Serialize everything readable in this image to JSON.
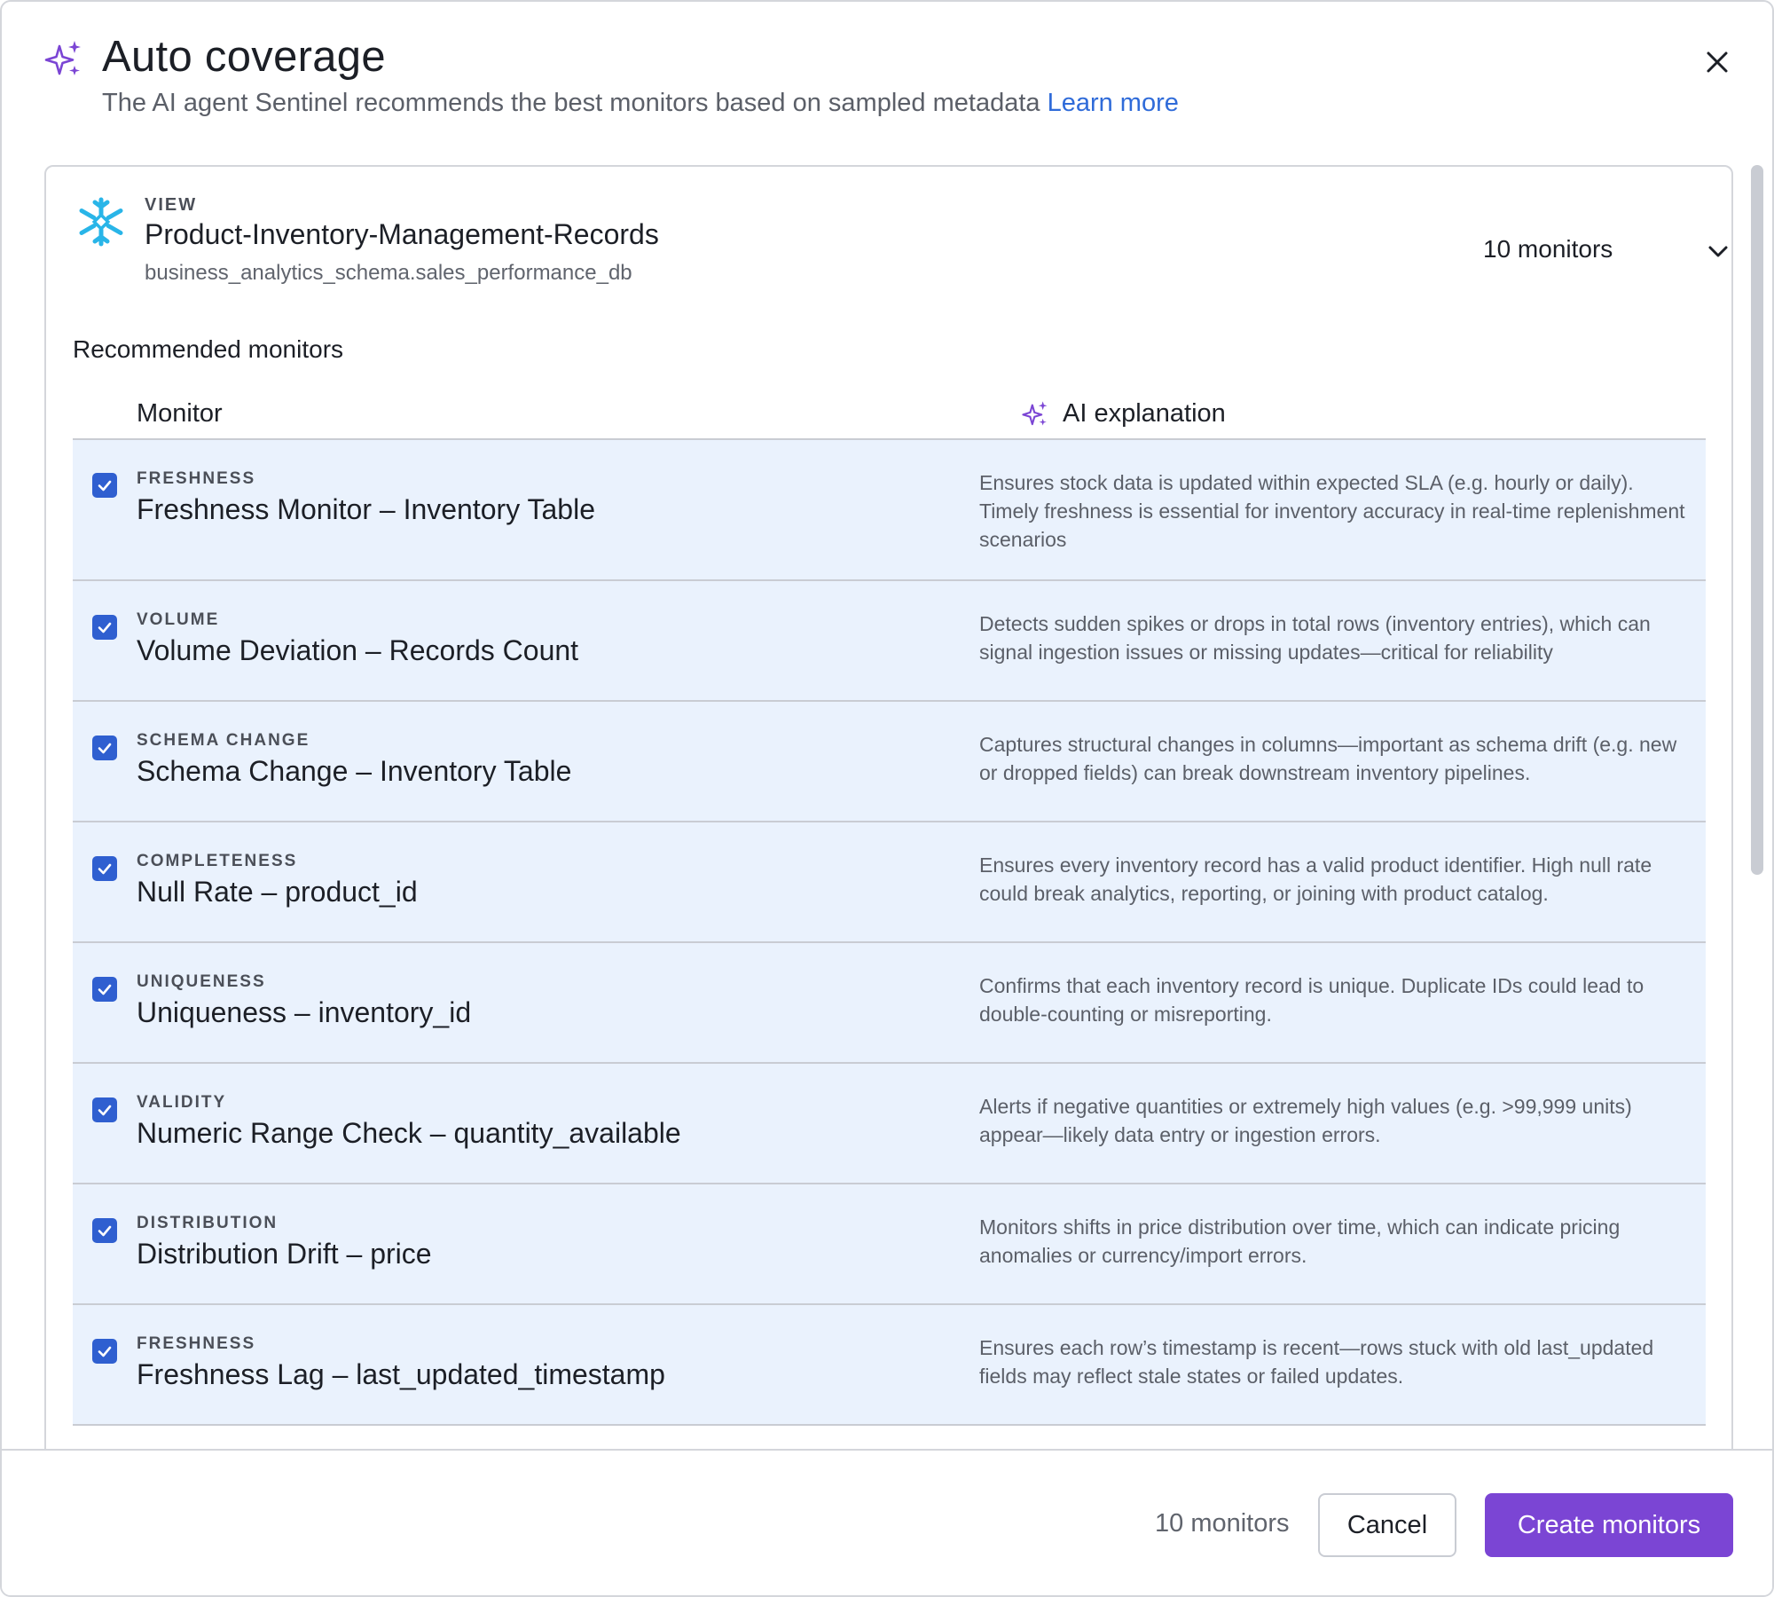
{
  "header": {
    "title": "Auto coverage",
    "subtitle": "The AI agent Sentinel recommends the best monitors based on sampled metadata",
    "learn_more": "Learn more",
    "sparkle_icon": "sparkle-icon",
    "close_icon": "close-icon"
  },
  "view": {
    "type_label": "VIEW",
    "name": "Product-Inventory-Management-Records",
    "path": "business_analytics_schema.sales_performance_db",
    "icon": "snowflake-icon",
    "monitor_count": "10 monitors"
  },
  "recommended_title": "Recommended monitors",
  "columns": {
    "monitor": "Monitor",
    "ai_explanation": "AI explanation"
  },
  "monitors": [
    {
      "type": "FRESHNESS",
      "name": "Freshness Monitor – Inventory Table",
      "explanation": "Ensures stock data is updated within expected SLA (e.g. hourly or daily). Timely freshness is essential for inventory accuracy in real-time replenishment scenarios",
      "checked": true
    },
    {
      "type": "VOLUME",
      "name": "Volume Deviation – Records Count",
      "explanation": "Detects sudden spikes or drops in total rows (inventory entries), which can signal ingestion issues or missing updates—critical for reliability",
      "checked": true
    },
    {
      "type": "SCHEMA CHANGE",
      "name": "Schema Change – Inventory Table",
      "explanation": "Captures structural changes in columns—important as schema drift (e.g. new or dropped fields) can break downstream inventory pipelines.",
      "checked": true
    },
    {
      "type": "COMPLETENESS",
      "name": "Null Rate – product_id",
      "explanation": "Ensures every inventory record has a valid product identifier. High null rate could break analytics, reporting, or joining with product catalog.",
      "checked": true
    },
    {
      "type": "UNIQUENESS",
      "name": "Uniqueness – inventory_id",
      "explanation": "Confirms that each inventory record is unique. Duplicate IDs could lead to double-counting or misreporting.",
      "checked": true
    },
    {
      "type": "VALIDITY",
      "name": "Numeric Range Check – quantity_available",
      "explanation": "Alerts if negative quantities or extremely high values (e.g. >99,999 units) appear—likely data entry or ingestion errors.",
      "checked": true
    },
    {
      "type": "DISTRIBUTION",
      "name": "Distribution Drift – price",
      "explanation": "Monitors shifts in price distribution over time, which can indicate pricing anomalies or currency/import errors.",
      "checked": true
    },
    {
      "type": "FRESHNESS",
      "name": "Freshness Lag – last_updated_timestamp",
      "explanation": "Ensures each row’s timestamp is recent—rows stuck with old last_updated fields may reflect stale states or failed updates.",
      "checked": true
    }
  ],
  "footer": {
    "monitor_count": "10 monitors",
    "cancel_label": "Cancel",
    "create_label": "Create monitors"
  },
  "colors": {
    "accent_purple": "#7b45d4",
    "checkbox_blue": "#2f5fd0",
    "row_bg": "#eaf2fd",
    "link_blue": "#2f6bd9",
    "snowflake_blue": "#29b5e8"
  }
}
